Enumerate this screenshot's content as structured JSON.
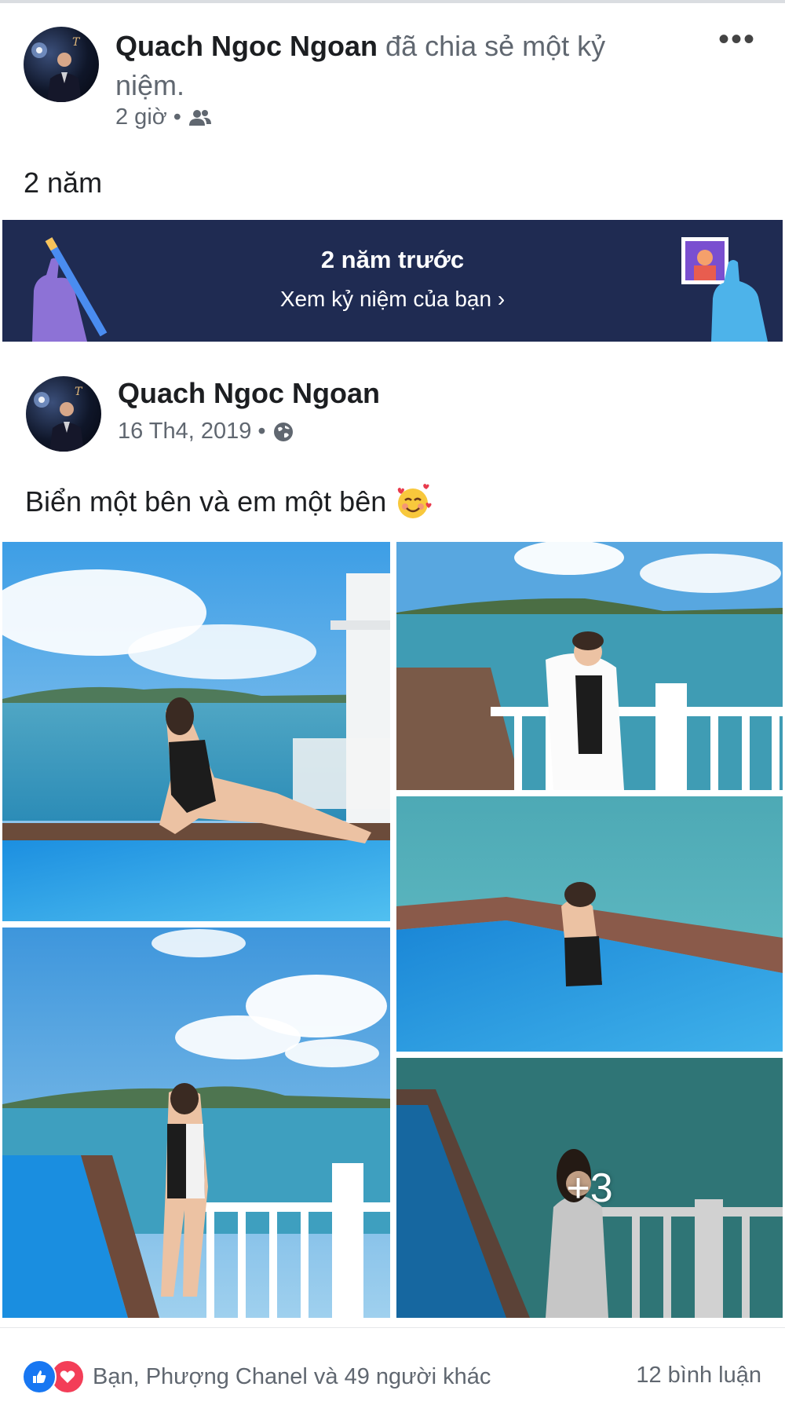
{
  "shared_header": {
    "author": "Quach Ngoc Ngoan",
    "action": "đã chia sẻ một kỷ niệm.",
    "time": "2 giờ",
    "audience_icon": "friends-icon",
    "more_icon": "more-options-icon"
  },
  "share_caption": "2 năm",
  "memory_banner": {
    "title": "2 năm trước",
    "link": "Xem kỷ niệm của bạn",
    "background": "#1f2b52"
  },
  "original_post": {
    "author": "Quach Ngoc Ngoan",
    "date": "16 Th4, 2019",
    "audience_icon": "globe-icon",
    "text": "Biển một bên và em một bên",
    "emoji": "smiling-face-with-hearts"
  },
  "photos": {
    "extra_count": "+3"
  },
  "footer": {
    "reactions_text": "Bạn, Phượng Chanel và 49 người khác",
    "comments_text": "12 bình luận",
    "like_color": "#1877f2",
    "love_color": "#f33e58"
  }
}
